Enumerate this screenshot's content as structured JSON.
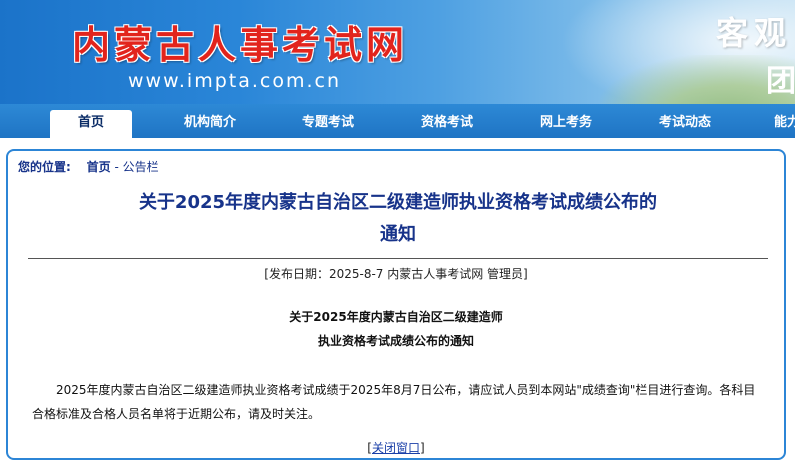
{
  "header": {
    "site_title": "内蒙古人事考试网",
    "site_url": "www.impta.com.cn",
    "slogan_line1": "客观",
    "slogan_line2": "团"
  },
  "nav": {
    "items": [
      {
        "label": "首页",
        "active": true
      },
      {
        "label": "机构简介",
        "active": false
      },
      {
        "label": "专题考试",
        "active": false
      },
      {
        "label": "资格考试",
        "active": false
      },
      {
        "label": "网上考务",
        "active": false
      },
      {
        "label": "考试动态",
        "active": false
      },
      {
        "label": "能力",
        "active": false
      }
    ]
  },
  "breadcrumb": {
    "label": "您的位置:",
    "home": "首页",
    "separator": "-",
    "current": "公告栏"
  },
  "article": {
    "title_line1": "关于2025年度内蒙古自治区二级建造师执业资格考试成绩公布的",
    "title_line2": "通知",
    "meta": "[发布日期：2025-8-7 内蒙古人事考试网 管理员]",
    "subtitle_line1": "关于2025年度内蒙古自治区二级建造师",
    "subtitle_line2": "执业资格考试成绩公布的通知",
    "body": "2025年度内蒙古自治区二级建造师执业资格考试成绩于2025年8月7日公布，请应试人员到本网站\"成绩查询\"栏目进行查询。各科目合格标准及合格人员名单将于近期公布，请及时关注。",
    "close_open": "[",
    "close_label": "关闭窗口",
    "close_close": "]"
  },
  "colors": {
    "banner_blue": "#1b73c9",
    "nav_blue": "#1f74c4",
    "title_red": "#e2241c",
    "heading_navy": "#17338a",
    "border_blue": "#2c85d6"
  }
}
